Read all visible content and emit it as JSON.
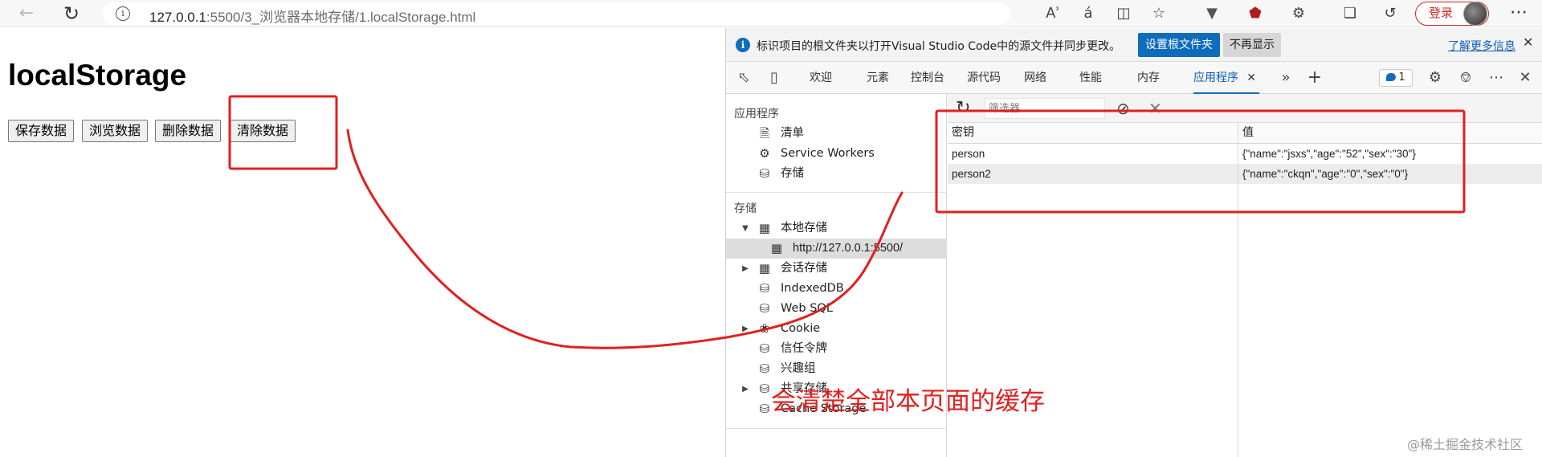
{
  "browser": {
    "url_host": "127.0.0.1",
    "url_rest": ":5500/3_浏览器本地存储/1.localStorage.html",
    "login_label": "登录",
    "toolbar_text_icons": [
      "Aʾ",
      "á"
    ]
  },
  "page": {
    "heading": "localStorage",
    "buttons": [
      "保存数据",
      "浏览数据",
      "删除数据",
      "清除数据"
    ]
  },
  "devtools": {
    "info_bar": {
      "text": "标识项目的根文件夹以打开Visual Studio Code中的源文件并同步更改。",
      "set_root_label": "设置根文件夹",
      "dismiss_label": "不再显示",
      "learn_more_label": "了解更多信息"
    },
    "tabs": [
      "欢迎",
      "元素",
      "控制台",
      "源代码",
      "网络",
      "性能",
      "内存",
      "应用程序"
    ],
    "active_tab": "应用程序",
    "message_count": "1",
    "sidebar": {
      "app_section": "应用程序",
      "app_items": [
        "清单",
        "Service Workers",
        "存储"
      ],
      "storage_section": "存储",
      "storage_items": [
        "本地存储",
        "http://127.0.0.1:5500/",
        "会话存储",
        "IndexedDB",
        "Web SQL",
        "Cookie",
        "信任令牌",
        "兴趣组",
        "共享存储",
        "Cache Storage"
      ]
    },
    "filter_placeholder": "筛选器",
    "table": {
      "columns": [
        "密钥",
        "值"
      ],
      "rows": [
        {
          "key": "person",
          "value": "{\"name\":\"jsxs\",\"age\":\"52\",\"sex\":\"30\"}"
        },
        {
          "key": "person2",
          "value": "{\"name\":\"ckqn\",\"age\":\"0\",\"sex\":\"0\"}"
        }
      ]
    }
  },
  "annotation": {
    "text": "会清楚全部本页面的缓存",
    "color": "#e0201f"
  },
  "watermark": "@稀土掘金技术社区"
}
